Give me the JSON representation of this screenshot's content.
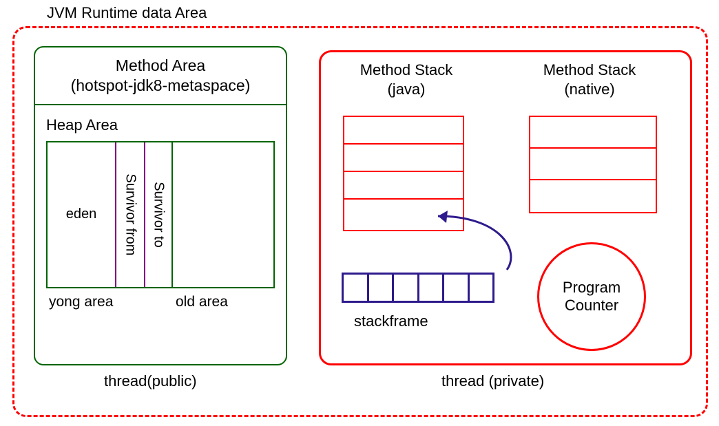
{
  "title": "JVM Runtime  data Area",
  "left": {
    "methodArea": {
      "line1": "Method Area",
      "line2": "(hotspot-jdk8-metaspace)"
    },
    "heapLabel": "Heap Area",
    "cells": {
      "eden": "eden",
      "survFrom": "Survivor from",
      "survTo": "Survivor to"
    },
    "yongArea": "yong area",
    "oldArea": "old area",
    "caption": "thread(public)"
  },
  "right": {
    "msJava": {
      "line1": "Method Stack",
      "line2": "(java)"
    },
    "msNative": {
      "line1": "Method Stack",
      "line2": "(native)"
    },
    "stackframe": "stackframe",
    "pc": {
      "line1": "Program",
      "line2": "Counter"
    },
    "caption": "thread (private)"
  },
  "watermark": ""
}
